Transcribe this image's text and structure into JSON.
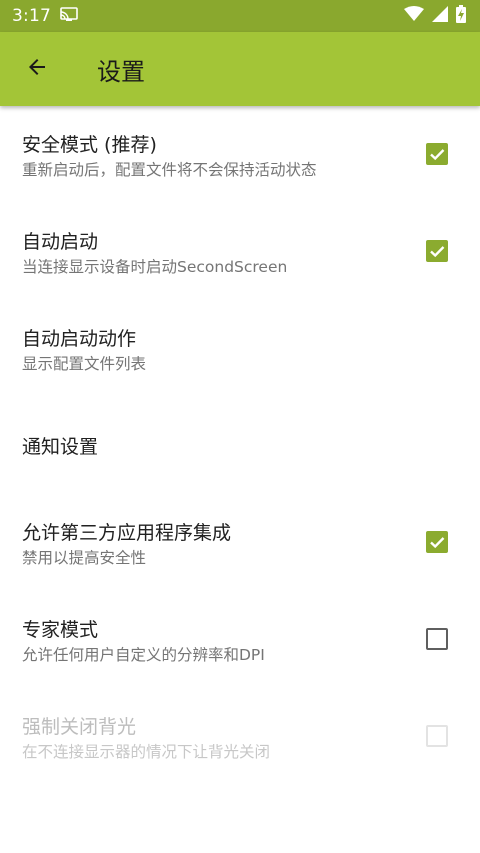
{
  "status_bar": {
    "time": "3:17",
    "icons": [
      "cast-icon",
      "wifi-icon",
      "cellular-signal-icon",
      "battery-charging-icon"
    ]
  },
  "app_bar": {
    "title": "设置",
    "back_icon": "arrow-back-icon",
    "color": "#a3c537"
  },
  "settings": [
    {
      "title": "安全模式 (推荐)",
      "summary": "重新启动后，配置文件将不会保持活动状态",
      "checkbox": "checked"
    },
    {
      "title": "自动启动",
      "summary": "当连接显示设备时启动SecondScreen",
      "checkbox": "checked"
    },
    {
      "title": "自动启动动作",
      "summary": "显示配置文件列表"
    },
    {
      "title": "通知设置"
    },
    {
      "title": "允许第三方应用程序集成",
      "summary": "禁用以提高安全性",
      "checkbox": "checked"
    },
    {
      "title": "专家模式",
      "summary": "允许任何用户自定义的分辨率和DPI",
      "checkbox": "unchecked"
    },
    {
      "title": "强制关闭背光",
      "summary": "在不连接显示器的情况下让背光关闭",
      "checkbox": "disabled"
    }
  ],
  "colors": {
    "accent": "#8bab2f",
    "status_bar": "#8aa82e",
    "disabled_text": "#bdbdbd"
  }
}
